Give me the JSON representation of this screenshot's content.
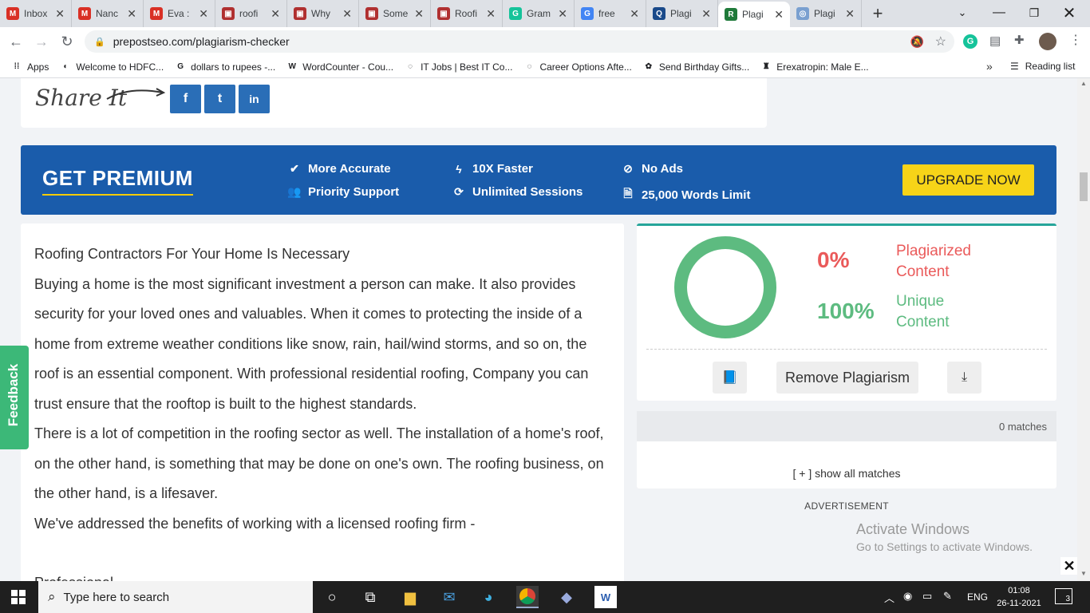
{
  "tabs": [
    {
      "label": "Inbox",
      "fav": "M",
      "color": "#d93025"
    },
    {
      "label": "Nanc",
      "fav": "M",
      "color": "#d93025"
    },
    {
      "label": "Eva :",
      "fav": "M",
      "color": "#d93025"
    },
    {
      "label": "roofi",
      "fav": "▣",
      "color": "#b03030"
    },
    {
      "label": "Why",
      "fav": "▣",
      "color": "#b03030"
    },
    {
      "label": "Some",
      "fav": "▣",
      "color": "#b03030"
    },
    {
      "label": "Roofi",
      "fav": "▣",
      "color": "#b03030"
    },
    {
      "label": "Gram",
      "fav": "G",
      "color": "#15c39a"
    },
    {
      "label": "free",
      "fav": "G",
      "color": "#4285f4"
    },
    {
      "label": "Plagi",
      "fav": "Q",
      "color": "#1a4a8a"
    },
    {
      "label": "Plagi",
      "fav": "R",
      "color": "#1f7a3a"
    },
    {
      "label": "Plagi",
      "fav": "◎",
      "color": "#7aa0d0"
    }
  ],
  "address": {
    "url": "prepostseo.com/plagiarism-checker"
  },
  "bookmarks": [
    {
      "label": "Apps",
      "icon": "apps-icon"
    },
    {
      "label": "Welcome to HDFC...",
      "icon": "globe-icon"
    },
    {
      "label": "dollars to rupees -...",
      "icon": "google-icon"
    },
    {
      "label": "WordCounter - Cou...",
      "icon": "w-icon"
    },
    {
      "label": "IT Jobs | Best IT Co...",
      "icon": "jobs-icon"
    },
    {
      "label": "Career Options Afte...",
      "icon": "jobs-icon"
    },
    {
      "label": "Send Birthday Gifts...",
      "icon": "gift-icon"
    },
    {
      "label": "Erexatropin: Male E...",
      "icon": "figure-icon"
    }
  ],
  "bookmarks_more": "»",
  "reading_list": "Reading list",
  "share": {
    "label": "Share It",
    "buttons": [
      "f",
      "t",
      "in"
    ]
  },
  "premium": {
    "title": "GET PREMIUM",
    "features": [
      "More Accurate",
      "Priority Support",
      "10X Faster",
      "Unlimited Sessions",
      "No Ads",
      "25,000 Words Limit"
    ],
    "upgrade": "UPGRADE NOW"
  },
  "article": {
    "paragraphs": [
      "Roofing Contractors For Your Home Is Necessary",
      "Buying a home is the most significant investment a person can make. It also provides security for your loved ones and valuables. When it comes to protecting the inside of a home from extreme weather conditions like snow, rain, hail/wind storms, and so on, the roof is an essential component. With professional residential roofing, Company you can trust ensure that the rooftop is built to the highest standards.",
      "There is a lot of competition in the roofing sector as well. The installation of a home's roof, on the other hand, is something that may be done on one's own. The roofing business, on the other hand, is a lifesaver.",
      "We've addressed the benefits of working with a licensed roofing firm -",
      "",
      "Professional"
    ]
  },
  "result": {
    "plagiarized_pct": "0%",
    "plagiarized_label": "Plagiarized Content",
    "unique_pct": "100%",
    "unique_label": "Unique Content",
    "unique_fraction": 1.0,
    "remove_btn": "Remove Plagiarism",
    "matches": "0 matches",
    "show_all": "[ + ] show all matches",
    "advert": "ADVERTISEMENT"
  },
  "watermark": {
    "line1": "Activate Windows",
    "line2": "Go to Settings to activate Windows."
  },
  "feedback": "Feedback",
  "taskbar": {
    "search": "Type here to search",
    "lang": "ENG",
    "time": "01:08",
    "date": "26-11-2021",
    "notif": "3"
  },
  "colors": {
    "premium": "#1a5cab",
    "upgrade": "#f7d418",
    "unique": "#5dbb80",
    "plag": "#ea5a5a",
    "feedback": "#3cb878"
  }
}
